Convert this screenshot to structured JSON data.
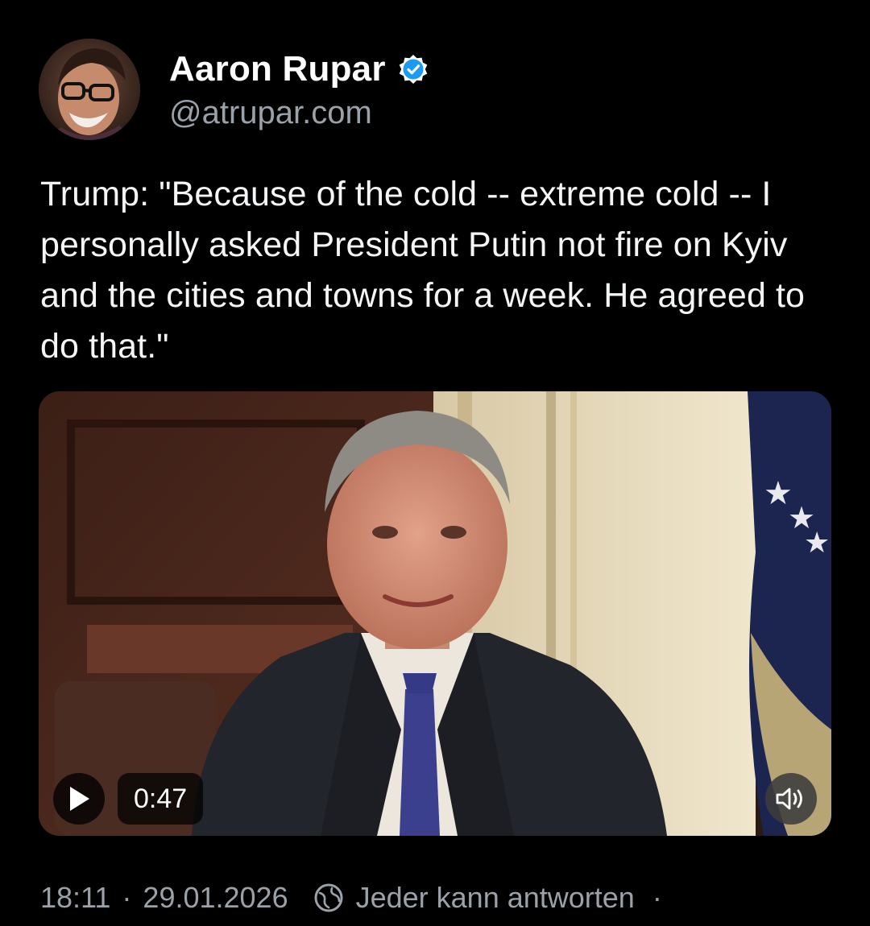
{
  "author": {
    "display_name": "Aaron Rupar",
    "handle": "@atrupar.com",
    "avatar_icon": "avatar-photo",
    "verified_icon": "verified-badge-icon",
    "verified_color": "#1d9bf0"
  },
  "post": {
    "text": "Trump: \"Because of the cold -- extreme cold -- I personally asked President Putin not fire on Kyiv and the cities and towns for a week. He agreed to do that.\""
  },
  "media": {
    "type": "video",
    "duration": "0:47",
    "play_icon": "play-icon",
    "mute_icon": "speaker-icon"
  },
  "footer": {
    "time": "18:11",
    "separator": "·",
    "date": "29.01.2026",
    "reply_icon": "globe-icon",
    "reply_setting": "Jeder kann antworten",
    "more": "·"
  },
  "colors": {
    "background": "#000000",
    "text": "#ffffff",
    "secondary_text": "#9aa1a8"
  }
}
